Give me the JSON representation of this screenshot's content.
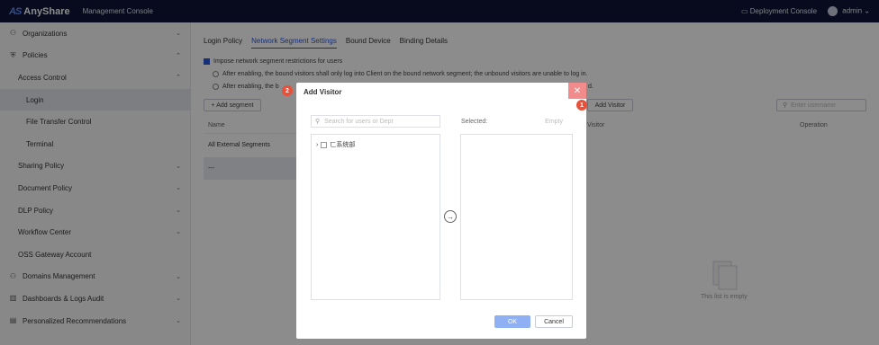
{
  "app": {
    "brand": "AnyShare",
    "brand_mark": "AS",
    "console_title": "Management Console"
  },
  "topbar": {
    "deployment_console": "Deployment Console",
    "user": "admin"
  },
  "sidebar": {
    "items": [
      {
        "label": "Organizations",
        "icon": "org-icon"
      },
      {
        "label": "Policies",
        "icon": "shield-icon"
      },
      {
        "label": "Access Control"
      },
      {
        "label": "Login"
      },
      {
        "label": "File Transfer Control"
      },
      {
        "label": "Terminal"
      },
      {
        "label": "Sharing Policy"
      },
      {
        "label": "Document Policy"
      },
      {
        "label": "DLP Policy"
      },
      {
        "label": "Workflow Center"
      },
      {
        "label": "OSS Gateway Account"
      },
      {
        "label": "Domains Management",
        "icon": "domain-icon"
      },
      {
        "label": "Dashboards & Logs Audit",
        "icon": "chart-icon"
      },
      {
        "label": "Personalized Recommendations",
        "icon": "list-icon"
      }
    ]
  },
  "tabs": [
    "Login Policy",
    "Network Segment Settings",
    "Bound Device",
    "Binding Details"
  ],
  "settings": {
    "checkbox_label": "Impose network segment restrictions for users",
    "radio1": "After enabling, the bound visitors shall only log into Client on the bound network segment; the unbound visitors are unable to log in.",
    "radio2_start": "After enabling, the b",
    "radio2_end": "d."
  },
  "segments": {
    "add_button": "+ Add segment",
    "column_name": "Name",
    "rows": [
      "All External Segments",
      "---"
    ]
  },
  "visitors": {
    "add_button": "Add Visitor",
    "search_placeholder": "Enter username",
    "column_visitor": "Visitor",
    "column_operation": "Operation",
    "empty_text": "This list is empty"
  },
  "dialog": {
    "title": "Add Visitor",
    "search_placeholder": "Search for users or Dept",
    "tree_root": "ㄈ系统部",
    "selected_label": "Selected:",
    "empty_link": "Empty",
    "ok": "OK",
    "cancel": "Cancel"
  },
  "markers": {
    "one": "1",
    "two": "2"
  }
}
